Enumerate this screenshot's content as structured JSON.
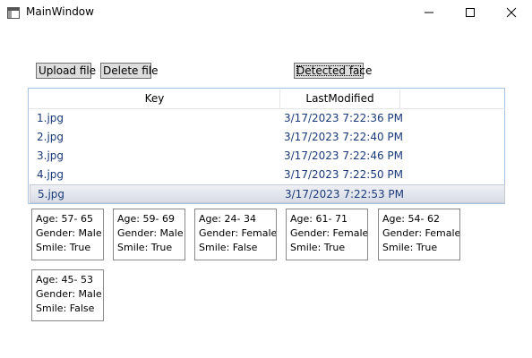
{
  "window": {
    "title": "MainWindow"
  },
  "toolbar": {
    "upload_label": "Upload file",
    "delete_label": "Delete file",
    "detect_label": "Detected face"
  },
  "files": {
    "columns": [
      "Key",
      "LastModified"
    ],
    "rows": [
      {
        "key": "1.jpg",
        "modified": "3/17/2023 7:22:36 PM",
        "selected": false
      },
      {
        "key": "2.jpg",
        "modified": "3/17/2023 7:22:40 PM",
        "selected": false
      },
      {
        "key": "3.jpg",
        "modified": "3/17/2023 7:22:46 PM",
        "selected": false
      },
      {
        "key": "4.jpg",
        "modified": "3/17/2023 7:22:50 PM",
        "selected": false
      },
      {
        "key": "5.jpg",
        "modified": "3/17/2023 7:22:53 PM",
        "selected": true
      }
    ]
  },
  "faces": [
    {
      "age": "Age: 57- 65",
      "gender": "Gender: Male",
      "smile": "Smile: True"
    },
    {
      "age": "Age: 59- 69",
      "gender": "Gender: Male",
      "smile": "Smile: True"
    },
    {
      "age": "Age: 24- 34",
      "gender": "Gender: Female",
      "smile": "Smile: False"
    },
    {
      "age": "Age: 61- 71",
      "gender": "Gender: Female",
      "smile": "Smile: True"
    },
    {
      "age": "Age: 54- 62",
      "gender": "Gender: Female",
      "smile": "Smile: True"
    },
    {
      "age": "Age: 45- 53",
      "gender": "Gender: Male",
      "smile": "Smile: False"
    }
  ],
  "colors": {
    "list_text": "#1a3a7a",
    "button_bg": "#dddddd",
    "list_border": "#a9c4e0"
  }
}
